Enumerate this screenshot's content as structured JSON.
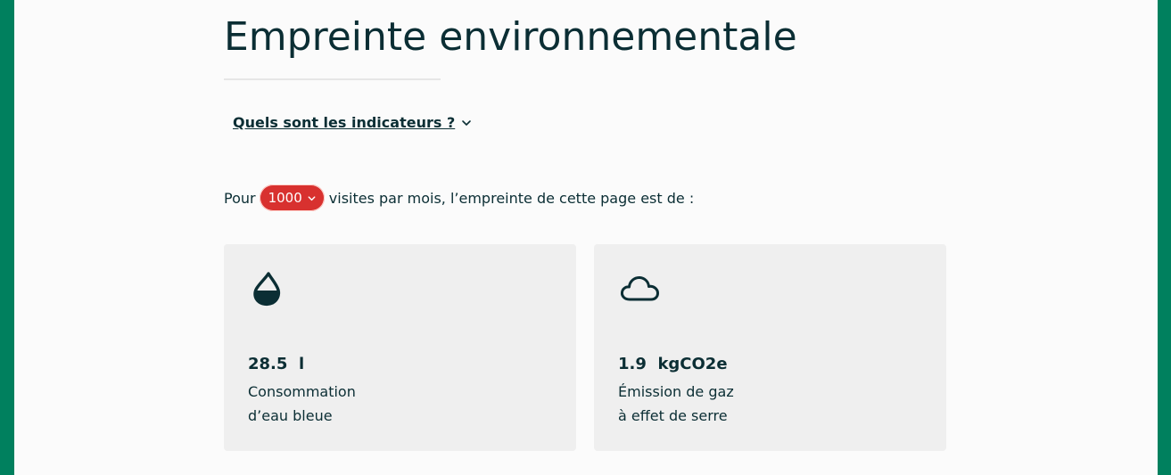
{
  "title": "Empreinte environnementale",
  "disclosure": {
    "label": "Quels sont les indicateurs ?",
    "icon": "chevron-down-icon"
  },
  "visits": {
    "prefix": "Pour",
    "selected_value": "1000",
    "suffix": "visites par mois, l’empreinte de cette page est de :"
  },
  "cards": [
    {
      "icon": "water-drop-icon",
      "value": "28.5",
      "unit": "l",
      "label_line1": "Consommation",
      "label_line2": "d’eau bleue"
    },
    {
      "icon": "cloud-icon",
      "value": "1.9",
      "unit": "kgCO2e",
      "label_line1": "Émission de gaz",
      "label_line2": "à effet de serre"
    }
  ],
  "colors": {
    "frame": "#00805e",
    "text": "#0b2e34",
    "select_bg": "#d8312f",
    "card_bg": "#efefef"
  }
}
